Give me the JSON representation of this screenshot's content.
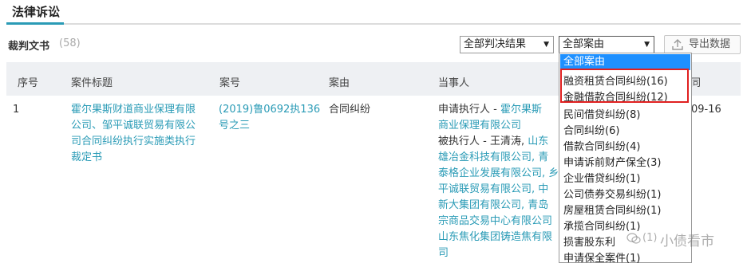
{
  "section": {
    "title": "法律诉讼"
  },
  "docs": {
    "label": "裁判文书",
    "count": "(58)"
  },
  "filters": {
    "result_select": "全部判决结果",
    "cause_select": "全部案由",
    "export_label": "导出数据"
  },
  "table": {
    "headers": [
      "序号",
      "案件标题",
      "案号",
      "案由",
      "当事人",
      "同"
    ],
    "row": {
      "index": "1",
      "title": [
        "霍尔果斯财道商业保理有限",
        "公司、邹平诚联贸易有限公",
        "司合同纠纷执行实施类执行",
        "裁定书"
      ],
      "case_no": [
        "(2019)鲁0692执136",
        "号之三"
      ],
      "cause": "合同纠纷",
      "party_label_1": "申请执行人 - ",
      "party_label_2": "被执行人 - 王清涛, ",
      "parties_links": [
        "霍尔果斯",
        "商业保理有限公司",
        "山东",
        "雄冶金科技有限公司, 青",
        "泰格企业发展有限公司, 乡",
        "平诚联贸易有限公司, 中",
        "新大集团有限公司, 青岛",
        "宗商品交易中心有限公司",
        "山东焦化集团铸造焦有限",
        "司"
      ],
      "date_fragment": "09-16"
    }
  },
  "dropdown": {
    "selected": "全部案由",
    "items": [
      "融资租赁合同纠纷(16)",
      "金融借款合同纠纷(12)",
      "民间借贷纠纷(8)",
      "合同纠纷(6)",
      "借款合同纠纷(4)",
      "申请诉前财产保全(3)",
      "企业借贷纠纷(1)",
      "公司债券交易纠纷(1)",
      "房屋租赁合同纠纷(1)",
      "承揽合同纠纷(1)",
      "损害股东利",
      "申请保全案件(1)"
    ]
  },
  "watermark": {
    "text": "小债看市",
    "partial": "(1)"
  }
}
